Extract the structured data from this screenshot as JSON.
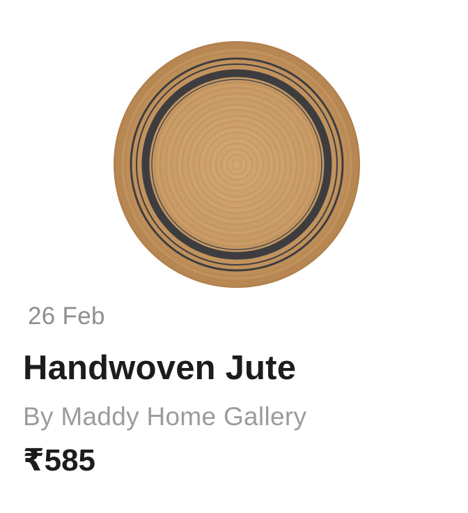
{
  "product": {
    "date": "26 Feb",
    "title": "Handwoven Jute",
    "seller": "By Maddy Home Gallery",
    "price": "₹585",
    "image_icon": "round-jute-rug-image",
    "colors": {
      "jute": "#c99b66",
      "stripe": "#3d3d3f",
      "title_text": "#1c1c1c",
      "muted_text": "#9c9c9c"
    }
  }
}
